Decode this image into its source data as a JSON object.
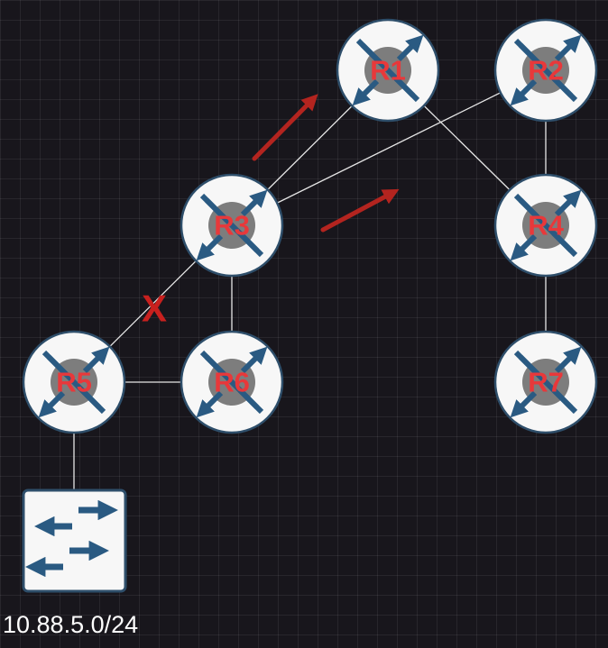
{
  "routers": [
    {
      "id": "r1",
      "label": "R1"
    },
    {
      "id": "r2",
      "label": "R2"
    },
    {
      "id": "r3",
      "label": "R3"
    },
    {
      "id": "r4",
      "label": "R4"
    },
    {
      "id": "r5",
      "label": "R5"
    },
    {
      "id": "r6",
      "label": "R6"
    },
    {
      "id": "r7",
      "label": "R7"
    }
  ],
  "links": [
    [
      "R1",
      "R3"
    ],
    [
      "R1",
      "R4"
    ],
    [
      "R2",
      "R3"
    ],
    [
      "R2",
      "R4"
    ],
    [
      "R3",
      "R5"
    ],
    [
      "R3",
      "R6"
    ],
    [
      "R4",
      "R7"
    ],
    [
      "R5",
      "R6"
    ],
    [
      "R5",
      "switch"
    ]
  ],
  "failed_link": {
    "between": [
      "R3",
      "R5"
    ],
    "mark": "X"
  },
  "switch": {
    "icon": "switch-icon"
  },
  "subnet": "10.88.5.0/24",
  "colors": {
    "background": "#18161c",
    "router_fill": "#f7f7f7",
    "router_core": "#7d7d7d",
    "router_arrows": "#2a5a82",
    "label": "#e8383a",
    "flow_arrow": "#b3241f",
    "failure_mark": "#c8201e",
    "link": "#e6e6e6"
  }
}
